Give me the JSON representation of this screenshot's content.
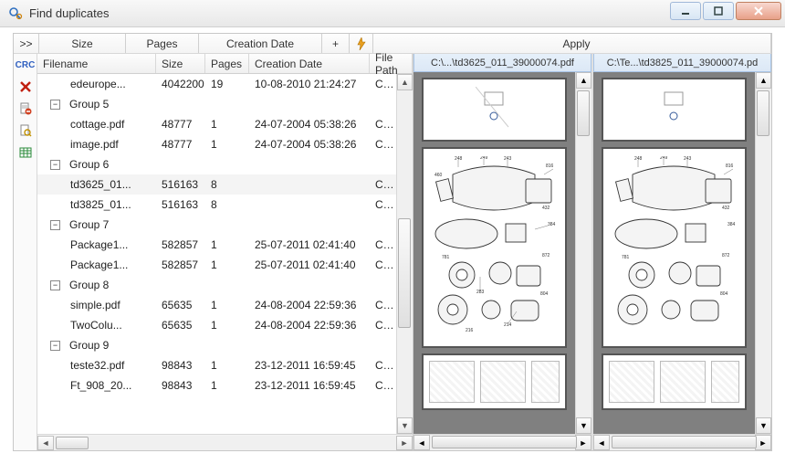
{
  "window": {
    "title": "Find duplicates"
  },
  "criteria": {
    "expand_label": ">>",
    "cols": {
      "size": "Size",
      "pages": "Pages",
      "date": "Creation Date",
      "plus": "+"
    },
    "apply": "Apply"
  },
  "side_tools": {
    "crc": "CRC"
  },
  "table": {
    "headers": {
      "filename": "Filename",
      "size": "Size",
      "pages": "Pages",
      "date": "Creation Date",
      "path": "File Path"
    },
    "rows": [
      {
        "indent": 1,
        "filename": "edeurope...",
        "size": "4042200",
        "pages": "19",
        "date": "10-08-2010 21:24:27",
        "path": "C:\\Te"
      },
      {
        "group": true,
        "label": "Group 5"
      },
      {
        "indent": 1,
        "filename": "cottage.pdf",
        "size": "48777",
        "pages": "1",
        "date": "24-07-2004 05:38:26",
        "path": "C:\\Te"
      },
      {
        "indent": 1,
        "filename": "image.pdf",
        "size": "48777",
        "pages": "1",
        "date": "24-07-2004 05:38:26",
        "path": "C:\\Te"
      },
      {
        "group": true,
        "label": "Group 6"
      },
      {
        "indent": 1,
        "selected": true,
        "filename": "td3625_01...",
        "size": "516163",
        "pages": "8",
        "date": "",
        "path": "C:\\Te"
      },
      {
        "indent": 1,
        "filename": "td3825_01...",
        "size": "516163",
        "pages": "8",
        "date": "",
        "path": "C:\\Te"
      },
      {
        "group": true,
        "label": "Group 7"
      },
      {
        "indent": 1,
        "filename": "Package1...",
        "size": "582857",
        "pages": "1",
        "date": "25-07-2011 02:41:40",
        "path": "C:\\Te"
      },
      {
        "indent": 1,
        "filename": "Package1...",
        "size": "582857",
        "pages": "1",
        "date": "25-07-2011 02:41:40",
        "path": "C:\\Te"
      },
      {
        "group": true,
        "label": "Group 8"
      },
      {
        "indent": 1,
        "filename": "simple.pdf",
        "size": "65635",
        "pages": "1",
        "date": "24-08-2004 22:59:36",
        "path": "C:\\Te"
      },
      {
        "indent": 1,
        "filename": "TwoColu...",
        "size": "65635",
        "pages": "1",
        "date": "24-08-2004 22:59:36",
        "path": "C:\\Te"
      },
      {
        "group": true,
        "label": "Group 9"
      },
      {
        "indent": 1,
        "filename": "teste32.pdf",
        "size": "98843",
        "pages": "1",
        "date": "23-12-2011 16:59:45",
        "path": "C:\\Te"
      },
      {
        "indent": 1,
        "filename": "Ft_908_20...",
        "size": "98843",
        "pages": "1",
        "date": "23-12-2011 16:59:45",
        "path": "C:\\Te"
      }
    ]
  },
  "previews": {
    "left_title": "C:\\...\\td3625_011_39000074.pdf",
    "right_title": "C:\\Te...\\td3825_011_39000074.pd"
  }
}
